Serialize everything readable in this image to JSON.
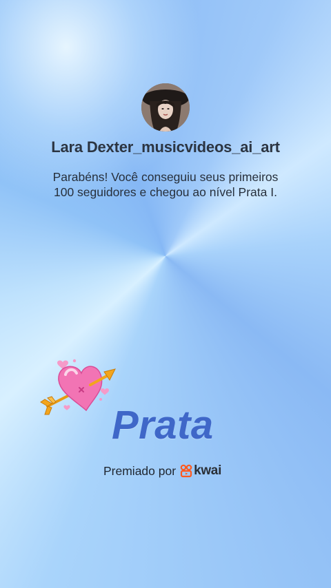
{
  "profile": {
    "username": "Lara Dexter_musicvideos_ai_art",
    "avatar_icon": "profile-avatar"
  },
  "message": {
    "line1": "Parabéns! Você conseguiu seus primeiros",
    "line2": "100 seguidores e chegou ao nível Prata I."
  },
  "badge": {
    "level_name": "Prata",
    "art_icon": "heart-arrow-icon"
  },
  "footer": {
    "awarded_label": "Premiado por",
    "brand_name": "kwai",
    "brand_icon": "kwai-logo-icon"
  },
  "colors": {
    "background_light": "#d8f0ff",
    "background_blue": "#8bbdf7",
    "level_text": "#3f67c8",
    "heart_pink": "#f274b4",
    "arrow_gold": "#f3a51c",
    "kwai_orange": "#ff5a1f"
  }
}
